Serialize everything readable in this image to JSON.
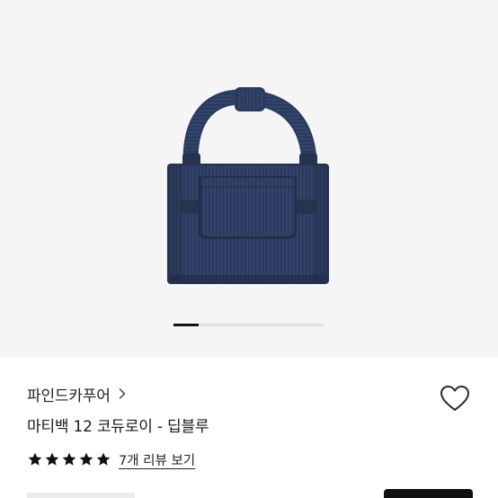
{
  "gallery": {
    "image_description": "navy corduroy mini top-handle bag",
    "current_slide_fraction": 0.17
  },
  "product": {
    "brand": "파인드카푸어",
    "title": "마티백 12 코듀로이 - 딥블루",
    "rating": {
      "stars": 5,
      "max": 5
    },
    "reviews_link": "7개 리뷰 보기"
  },
  "icons": {
    "brand_chevron": "chevron-right-icon",
    "wishlist": "heart-outline-icon",
    "star": "star-filled-icon"
  },
  "colors": {
    "bag": "#2f3f5e",
    "bag_shadow": "#1f2b44",
    "gallery_bg": "#f5f5f5",
    "star": "#111111",
    "button": "#111111"
  }
}
